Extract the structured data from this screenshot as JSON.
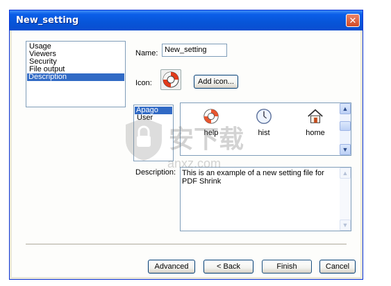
{
  "window": {
    "title": "New_setting"
  },
  "nav_items": [
    {
      "label": "Usage"
    },
    {
      "label": "Viewers"
    },
    {
      "label": "Security"
    },
    {
      "label": "File output"
    },
    {
      "label": "Description"
    }
  ],
  "name_label": "Name:",
  "name_value": "New_setting",
  "icon_label": "Icon:",
  "add_icon_label": "Add icon...",
  "icon_sets": [
    {
      "label": "Apago"
    },
    {
      "label": "User"
    }
  ],
  "gallery": [
    {
      "label": "help",
      "icon": "lifebuoy-icon"
    },
    {
      "label": "hist",
      "icon": "clock-icon"
    },
    {
      "label": "home",
      "icon": "house-icon"
    }
  ],
  "description_label": "Description:",
  "description_text": "This is an example of a new setting file for PDF Shrink",
  "buttons": {
    "advanced": "Advanced",
    "back": "< Back",
    "finish": "Finish",
    "cancel": "Cancel"
  },
  "watermark": {
    "text": "安下载",
    "subtext": "anxz.com"
  }
}
